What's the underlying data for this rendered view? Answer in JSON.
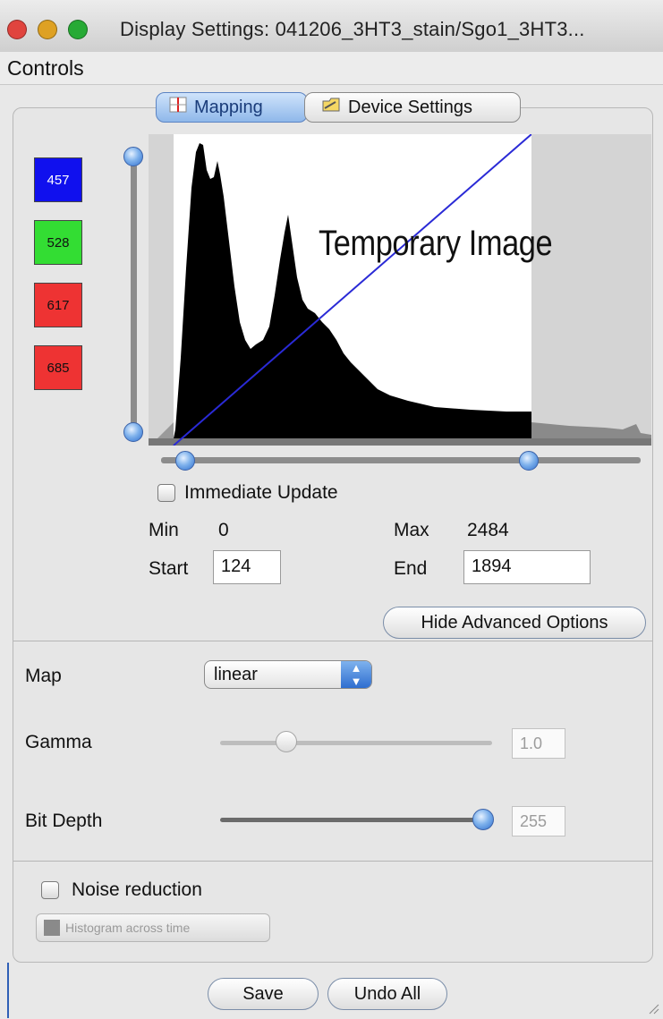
{
  "window": {
    "title": "Display Settings:  041206_3HT3_stain/Sgo1_3HT3...",
    "traffic_colors": [
      "#e0443e",
      "#dea123",
      "#27aa35"
    ]
  },
  "menu": {
    "controls": "Controls"
  },
  "tabs": [
    {
      "label": "Mapping",
      "icon": "mapping-icon",
      "active": true
    },
    {
      "label": "Device Settings",
      "icon": "device-settings-icon",
      "active": false
    }
  ],
  "channels": [
    {
      "label": "457",
      "color": "#1010ee",
      "text_color": "#ffffff"
    },
    {
      "label": "528",
      "color": "#33dd33",
      "text_color": "#1a1a1a"
    },
    {
      "label": "617",
      "color": "#ee3333",
      "text_color": "#1a1a1a"
    },
    {
      "label": "685",
      "color": "#ee3333",
      "text_color": "#1a1a1a"
    }
  ],
  "plot": {
    "overlay_text": "Temporary Image"
  },
  "immediate_update": {
    "label": "Immediate Update",
    "checked": false
  },
  "range": {
    "min_label": "Min",
    "min_value": "0",
    "max_label": "Max",
    "max_value": "2484",
    "start_label": "Start",
    "start_value": "124",
    "end_label": "End",
    "end_value": "1894"
  },
  "hide_advanced": {
    "label": "Hide Advanced Options"
  },
  "map": {
    "label": "Map",
    "value": "linear"
  },
  "gamma": {
    "label": "Gamma",
    "value": "1.0"
  },
  "bit_depth": {
    "label": "Bit Depth",
    "value": "255"
  },
  "noise_reduction": {
    "label": "Noise reduction",
    "checked": false
  },
  "histogram_across_time": {
    "label": "Histogram across time",
    "enabled": false
  },
  "buttons": {
    "save": "Save",
    "undo_all": "Undo All"
  },
  "colors": {
    "accent": "#2f6fcf",
    "line": "#2a2ad6"
  }
}
